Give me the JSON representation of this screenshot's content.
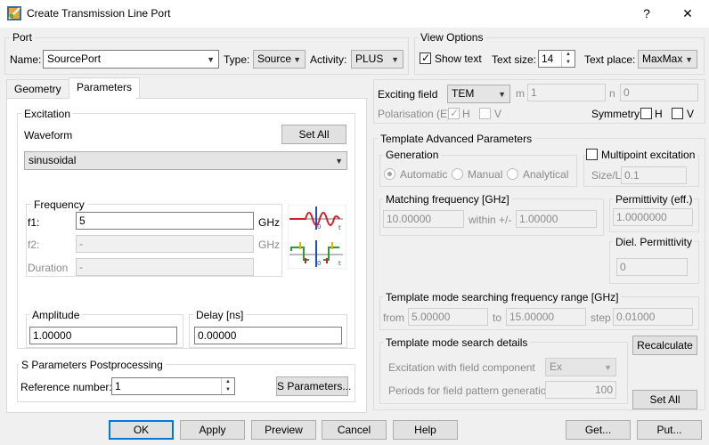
{
  "window": {
    "title": "Create Transmission Line Port",
    "help_glyph": "?",
    "close_glyph": "✕"
  },
  "port": {
    "group_label": "Port",
    "name_label": "Name:",
    "name_value": "SourcePort",
    "type_label": "Type:",
    "type_value": "Source",
    "activity_label": "Activity:",
    "activity_value": "PLUS"
  },
  "view_options": {
    "group_label": "View Options",
    "show_text_label": "Show text",
    "show_text_checked": true,
    "text_size_label": "Text size:",
    "text_size_value": "14",
    "text_place_label": "Text place:",
    "text_place_value": "MaxMax"
  },
  "tabs": [
    {
      "label": "Geometry"
    },
    {
      "label": "Parameters"
    }
  ],
  "excitation": {
    "group_label": "Excitation",
    "waveform_label": "Waveform",
    "set_all_label": "Set All",
    "waveform_value": "sinusoidal"
  },
  "frequency": {
    "group_label": "Frequency",
    "f1_label": "f1:",
    "f1_value": "5",
    "f1_unit": "GHz",
    "f2_label": "f2:",
    "f2_value": "-",
    "f2_unit": "GHz",
    "duration_label": "Duration",
    "duration_value": "-"
  },
  "amplitude": {
    "group_label": "Amplitude",
    "value": "1.00000"
  },
  "delay": {
    "group_label": "Delay [ns]",
    "value": "0.00000"
  },
  "s_params": {
    "group_label": "S Parameters Postprocessing",
    "ref_label": "Reference number:",
    "ref_value": "1",
    "button_label": "S Parameters..."
  },
  "exciting": {
    "exciting_field_label": "Exciting field",
    "exciting_field_value": "TEM",
    "m_label": "m",
    "m_value": "1",
    "n_label": "n",
    "n_value": "0",
    "polarisation_label": "Polarisation (E)",
    "pol_h_label": "H",
    "pol_v_label": "V",
    "symmetry_label": "Symmetry",
    "sym_h_label": "H",
    "sym_v_label": "V"
  },
  "template_adv": {
    "group_label": "Template Advanced Parameters",
    "generation": {
      "group_label": "Generation",
      "automatic_label": "Automatic",
      "manual_label": "Manual",
      "analytical_label": "Analytical"
    },
    "multipoint_label": "Multipoint excitation",
    "size_l_label": "Size/L",
    "size_l_value": "0.1",
    "matching": {
      "group_label": "Matching frequency [GHz]",
      "value": "10.00000",
      "within_label": "within +/-",
      "within_value": "1.00000"
    },
    "permittivity": {
      "group_label": "Permittivity (eff.)",
      "value": "1.0000000"
    },
    "diel": {
      "group_label": "Diel. Permittivity",
      "value": "0"
    },
    "search_range": {
      "group_label": "Template mode searching frequency range [GHz]",
      "from_label": "from",
      "from_value": "5.00000",
      "to_label": "to",
      "to_value": "15.00000",
      "step_label": "step",
      "step_value": "0.01000"
    },
    "search_details": {
      "group_label": "Template mode search details",
      "field_component_label": "Excitation with field component",
      "field_component_value": "Ex",
      "periods_label": "Periods for field pattern generation",
      "periods_value": "100"
    },
    "recalculate_label": "Recalculate",
    "set_all_label": "Set All"
  },
  "bottom_buttons": {
    "ok": "OK",
    "apply": "Apply",
    "preview": "Preview",
    "cancel": "Cancel",
    "help": "Help",
    "get": "Get...",
    "put": "Put..."
  }
}
